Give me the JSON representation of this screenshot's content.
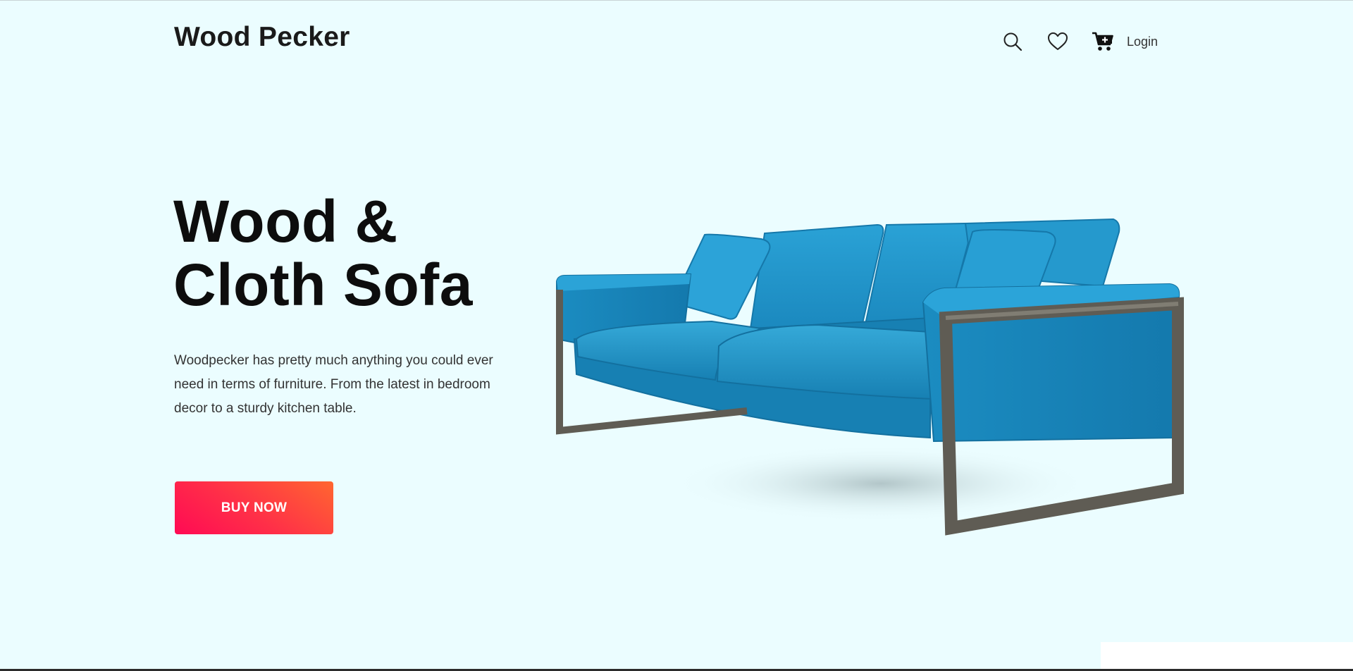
{
  "header": {
    "brand": "Wood Pecker",
    "nav": {
      "search_icon": "search-icon",
      "wishlist_icon": "heart-icon",
      "cart_icon": "cart-plus-icon",
      "login_label": "Login"
    }
  },
  "hero": {
    "title_line1": "Wood &",
    "title_line2": "Cloth Sofa",
    "description": "Woodpecker has pretty much anything you could ever need in terms of furniture. From the latest in bedroom decor to a sturdy kitchen table.",
    "cta_label": "BUY NOW",
    "image": "blue-sofa-image"
  },
  "colors": {
    "background": "#ebfdff",
    "cta_gradient_start": "#ff0a54",
    "cta_gradient_end": "#ff6630",
    "sofa_blue": "#1e95c8",
    "frame": "#5c5a52"
  }
}
